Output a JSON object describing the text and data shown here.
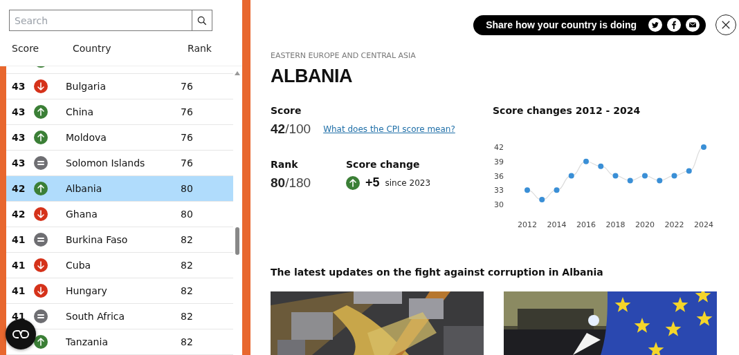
{
  "search": {
    "placeholder": "Search"
  },
  "table": {
    "columns": [
      "Score",
      "Country",
      "Rank"
    ],
    "rows": [
      {
        "kind": "up",
        "selected": false
      },
      {
        "score": "43",
        "kind": "down",
        "country": "Bulgaria",
        "rank": "76",
        "selected": false
      },
      {
        "score": "43",
        "kind": "up",
        "country": "China",
        "rank": "76",
        "selected": false
      },
      {
        "score": "43",
        "kind": "up",
        "country": "Moldova",
        "rank": "76",
        "selected": false
      },
      {
        "score": "43",
        "kind": "same",
        "country": "Solomon Islands",
        "rank": "76",
        "selected": false
      },
      {
        "score": "42",
        "kind": "up",
        "country": "Albania",
        "rank": "80",
        "selected": true
      },
      {
        "score": "42",
        "kind": "down",
        "country": "Ghana",
        "rank": "80",
        "selected": false
      },
      {
        "score": "41",
        "kind": "same",
        "country": "Burkina Faso",
        "rank": "82",
        "selected": false
      },
      {
        "score": "41",
        "kind": "down",
        "country": "Cuba",
        "rank": "82",
        "selected": false
      },
      {
        "score": "41",
        "kind": "down",
        "country": "Hungary",
        "rank": "82",
        "selected": false
      },
      {
        "score": "41",
        "kind": "same",
        "country": "South Africa",
        "rank": "82",
        "selected": false
      },
      {
        "kind": "up",
        "country": "Tanzania",
        "rank": "82",
        "selected": false
      }
    ]
  },
  "share": {
    "label": "Share how your country is doing",
    "networks": [
      {
        "kind": "twitter"
      },
      {
        "kind": "facebook"
      },
      {
        "kind": "email"
      }
    ]
  },
  "country": {
    "region": "EASTERN EUROPE AND CENTRAL ASIA",
    "name": "ALBANIA",
    "score_label": "Score",
    "score": "42",
    "score_max": "/100",
    "score_link": "What does the CPI score mean?",
    "rank_label": "Rank",
    "rank": "80",
    "rank_max": "/180",
    "change_label": "Score change",
    "change_icon": {
      "kind": "up"
    },
    "change_value": "+5",
    "change_since": "since 2023"
  },
  "chart": {
    "chart_data": {
      "type": "line",
      "title": "Score changes 2012 - 2024",
      "x": [
        2012,
        2013,
        2014,
        2015,
        2016,
        2017,
        2018,
        2019,
        2020,
        2021,
        2022,
        2023,
        2024
      ],
      "series": [
        {
          "color": "#3a8fd6",
          "marker": "circle",
          "values": [
            33,
            31,
            33,
            36,
            39,
            38,
            36,
            35,
            36,
            35,
            36,
            37,
            42
          ]
        }
      ],
      "xlim": [
        2012,
        2024
      ],
      "ylim": [
        30,
        42
      ],
      "yticks": [
        30,
        33,
        36,
        39,
        42
      ],
      "xticks": [
        2012,
        2014,
        2016,
        2018,
        2020,
        2022,
        2024
      ]
    }
  },
  "updates": {
    "heading": "The latest updates on the fight against corruption in Albania"
  }
}
